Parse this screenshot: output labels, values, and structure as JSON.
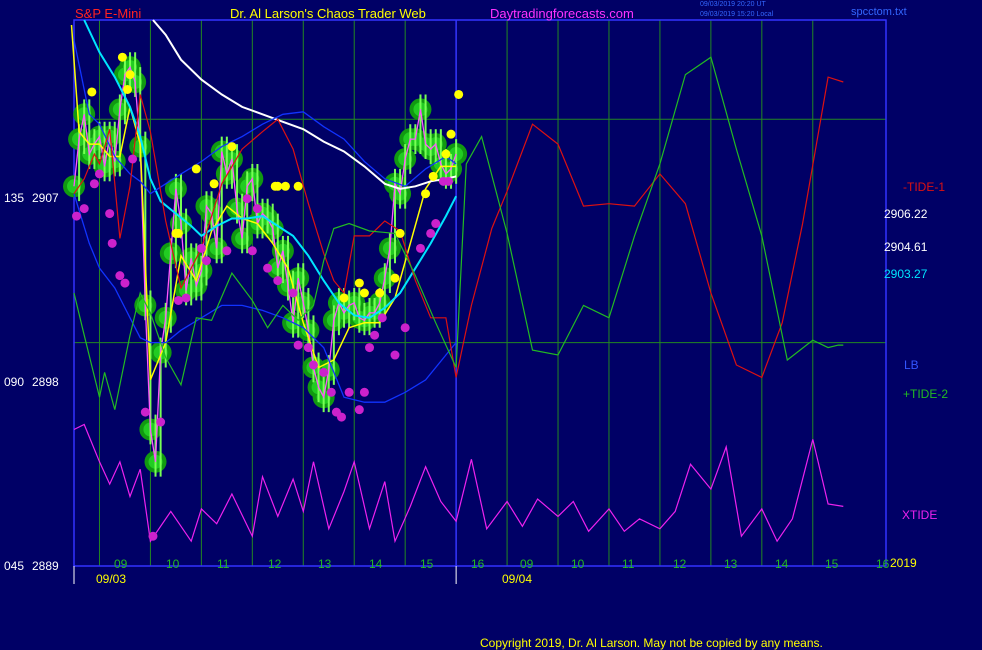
{
  "header": {
    "symbol": "S&P E-Mini",
    "site": "Dr. Al Larson's Chaos Trader Web",
    "url": "Daytradingforecasts.com",
    "ts_utc": "09/03/2019 20:20 UT",
    "ts_local": "09/03/2019 15:20 Local",
    "file": "spcctom.txt"
  },
  "footer": {
    "copyright": "Copyright 2019, Dr. Al Larson. May not be copied by any means."
  },
  "colors": {
    "background": "#000066",
    "frame": "#3333ff",
    "grid": "#228822",
    "price_lime": "#00ee00",
    "fast_ma_yellow": "#ffff00",
    "ma_cyan": "#00e5ff",
    "ma_white": "#ffffff",
    "bands_blue": "#1133ff",
    "tide1_red": "#dd1111",
    "tide2_green": "#22bb22",
    "xtide_magenta": "#ee22ee",
    "marker_yellow": "#ffff00",
    "marker_magenta": "#cc22cc"
  },
  "chart_data": {
    "type": "line",
    "x_axis": {
      "session1_date": "09/03",
      "session2_date": "09/04",
      "session1_hours": [
        "09",
        "10",
        "11",
        "12",
        "13",
        "14",
        "15",
        "16"
      ],
      "session2_hours": [
        "09",
        "10",
        "11",
        "12",
        "13",
        "14",
        "15",
        "16"
      ],
      "year": "2019"
    },
    "y_axis": {
      "ylim": [
        2889,
        2911
      ],
      "ticks": [
        {
          "prefix": "045",
          "value": "2889",
          "v": 2889
        },
        {
          "prefix": "090",
          "value": "2898",
          "v": 2898
        },
        {
          "prefix": "135",
          "value": "2907",
          "v": 2907
        }
      ]
    },
    "right_labels": {
      "value_1": "2906.22",
      "value_2": "2904.61",
      "value_3": "2903.27",
      "tide1": "-TIDE-1",
      "lb": "LB",
      "tide2": "+TIDE-2",
      "xtide": "XTIDE",
      "year": "2019"
    },
    "price": {
      "t": [
        8.5,
        8.6,
        8.7,
        8.8,
        8.9,
        9.0,
        9.1,
        9.2,
        9.3,
        9.4,
        9.5,
        9.6,
        9.7,
        9.8,
        9.9,
        10.0,
        10.1,
        10.2,
        10.3,
        10.4,
        10.5,
        10.6,
        10.7,
        10.8,
        10.9,
        11.0,
        11.1,
        11.2,
        11.3,
        11.4,
        11.5,
        11.6,
        11.7,
        11.8,
        11.9,
        12.0,
        12.1,
        12.2,
        12.3,
        12.4,
        12.5,
        12.6,
        12.7,
        12.8,
        12.9,
        13.0,
        13.1,
        13.2,
        13.3,
        13.4,
        13.5,
        13.6,
        13.7,
        13.8,
        13.9,
        14.0,
        14.1,
        14.2,
        14.3,
        14.4,
        14.5,
        14.6,
        14.7,
        14.8,
        14.9,
        15.0,
        15.1,
        15.2,
        15.3,
        15.4,
        15.5,
        15.6,
        15.7,
        15.8,
        15.9,
        16.0
      ],
      "v": [
        2904.3,
        2906.2,
        2907.2,
        2905.6,
        2906.0,
        2906.3,
        2905.1,
        2906.3,
        2905.3,
        2907.4,
        2908.8,
        2909.1,
        2908.5,
        2905.9,
        2899.5,
        2894.5,
        2893.2,
        2897.6,
        2899.0,
        2901.6,
        2904.2,
        2902.8,
        2900.1,
        2901.4,
        2900.3,
        2900.9,
        2903.5,
        2903.2,
        2901.8,
        2905.7,
        2904.8,
        2905.4,
        2903.4,
        2902.2,
        2904.3,
        2904.6,
        2902.8,
        2903.2,
        2903.0,
        2902.6,
        2901.0,
        2901.7,
        2900.3,
        2898.8,
        2900.6,
        2899.6,
        2898.5,
        2897.0,
        2896.2,
        2895.8,
        2896.9,
        2898.9,
        2899.6,
        2899.2,
        2899.5,
        2899.6,
        2899.0,
        2898.9,
        2899.2,
        2899.2,
        2899.6,
        2900.6,
        2901.8,
        2904.4,
        2904.0,
        2905.4,
        2906.2,
        2906.2,
        2907.4,
        2906.0,
        2905.8,
        2906.0,
        2905.2,
        2904.8,
        2905.0,
        2905.6
      ]
    },
    "series": [
      {
        "t": [
          8.45,
          8.6,
          8.8,
          9.0,
          9.2,
          9.4,
          9.6,
          9.8,
          10.0,
          10.3,
          10.6,
          10.9,
          11.2,
          11.5,
          11.8,
          12.1,
          12.4,
          12.7,
          13.0,
          13.3,
          13.6,
          13.9,
          14.2,
          14.5,
          14.8,
          15.1,
          15.4,
          15.7,
          16.0
        ],
        "v": [
          2910.8,
          2906.5,
          2906.0,
          2906.0,
          2905.5,
          2905.5,
          2907.5,
          2906.0,
          2896.5,
          2898.0,
          2901.5,
          2900.5,
          2902.5,
          2903.5,
          2903.0,
          2902.8,
          2902.0,
          2901.0,
          2898.8,
          2897.0,
          2897.3,
          2898.6,
          2898.8,
          2898.8,
          2899.8,
          2902.0,
          2904.2,
          2905.1,
          2905.1
        ]
      },
      {
        "t": [
          8.7,
          9.0,
          9.3,
          9.6,
          9.8,
          10.0,
          10.2,
          10.5,
          10.8,
          11.0,
          11.3,
          11.6,
          11.9,
          12.2,
          12.5,
          12.8,
          13.1,
          13.4,
          13.7,
          14.0,
          14.3,
          14.6,
          14.9,
          15.2,
          15.5,
          15.8,
          16.0
        ],
        "v": [
          2911.0,
          2909.7,
          2908.7,
          2907.5,
          2906.3,
          2904.6,
          2903.7,
          2903.2,
          2902.7,
          2902.3,
          2902.7,
          2903.0,
          2903.0,
          2903.1,
          2902.7,
          2902.3,
          2901.5,
          2900.5,
          2899.6,
          2899.1,
          2899.0,
          2899.4,
          2900.0,
          2901.0,
          2902.0,
          2903.1,
          2903.9
        ]
      },
      {
        "t": [
          10.05,
          10.3,
          10.6,
          11.0,
          11.4,
          11.8,
          12.2,
          12.6,
          13.0,
          13.4,
          13.8,
          14.2,
          14.6,
          14.9,
          15.2,
          15.5,
          15.8,
          16.0
        ],
        "v": [
          2911.0,
          2910.4,
          2909.4,
          2908.6,
          2908.0,
          2907.5,
          2907.2,
          2906.9,
          2906.6,
          2906.1,
          2905.7,
          2905.1,
          2904.4,
          2904.2,
          2904.3,
          2904.5,
          2904.6,
          2904.7
        ]
      },
      {
        "t": [
          8.5,
          8.8,
          9.0,
          9.3,
          9.6,
          9.8,
          10.0,
          10.3,
          10.6,
          11.0,
          11.4,
          11.8,
          12.2,
          12.6,
          13.0,
          13.4,
          13.8,
          14.2,
          14.6,
          15.0,
          15.4,
          15.8,
          16.0
        ],
        "v": [
          2910.2,
          2907.2,
          2906.8,
          2905.5,
          2904.8,
          2904.5,
          2904.0,
          2904.4,
          2904.8,
          2905.3,
          2905.9,
          2906.3,
          2906.8,
          2907.2,
          2907.3,
          2906.7,
          2906.2,
          2905.3,
          2904.6,
          2904.3,
          2905.0,
          2905.5,
          2905.2
        ]
      },
      {
        "t": [
          8.5,
          8.8,
          9.0,
          9.3,
          9.6,
          9.8,
          10.0,
          10.3,
          10.6,
          11.0,
          11.4,
          11.8,
          12.2,
          12.6,
          13.0,
          13.4,
          13.8,
          14.2,
          14.6,
          15.0,
          15.4,
          15.8,
          16.0
        ],
        "v": [
          2904.0,
          2902.0,
          2901.0,
          2900.2,
          2899.0,
          2898.2,
          2898.0,
          2898.0,
          2898.5,
          2899.0,
          2899.5,
          2899.5,
          2899.3,
          2899.0,
          2898.6,
          2897.8,
          2895.8,
          2895.6,
          2895.6,
          2896.0,
          2896.5,
          2897.5,
          2898.0
        ]
      },
      {
        "t": [
          8.5,
          8.7,
          8.9,
          9.0,
          9.2,
          9.4,
          9.6,
          9.8,
          10.0,
          10.3,
          10.6,
          11.0,
          11.4,
          11.8,
          12.2,
          12.5,
          12.8,
          13.1,
          13.4,
          13.6,
          13.8,
          14.0,
          14.3,
          14.6,
          14.9,
          15.2,
          15.5,
          15.8,
          16.0,
          16.3,
          16.7,
          17.0,
          17.5,
          18.0,
          18.5,
          19.0,
          19.5,
          20.0,
          20.5,
          21.0,
          21.5,
          22.0,
          22.4,
          22.8,
          23.3,
          23.6
        ],
        "v": [
          2904.0,
          2904.6,
          2905.6,
          2905.2,
          2906.6,
          2902.2,
          2904.3,
          2908.0,
          2906.5,
          2902.9,
          2900.2,
          2901.8,
          2904.4,
          2905.8,
          2906.5,
          2907.0,
          2905.8,
          2903.6,
          2901.6,
          2900.5,
          2900.0,
          2902.3,
          2902.3,
          2902.9,
          2902.5,
          2900.5,
          2899.0,
          2899.0,
          2896.6,
          2899.5,
          2902.6,
          2904.1,
          2906.8,
          2906.0,
          2903.5,
          2903.6,
          2903.5,
          2904.8,
          2903.6,
          2900.0,
          2897.1,
          2896.6,
          2898.8,
          2902.8,
          2908.7,
          2908.5
        ]
      },
      {
        "t": [
          8.5,
          8.7,
          9.0,
          9.1,
          9.3,
          9.6,
          9.8,
          10.0,
          10.3,
          10.6,
          10.9,
          11.2,
          11.6,
          12.0,
          12.3,
          12.6,
          12.9,
          13.2,
          13.4,
          13.6,
          13.9,
          14.3,
          14.8,
          15.2,
          15.6,
          16.0,
          16.2,
          16.5,
          17.0,
          17.5,
          18.0,
          18.5,
          19.0,
          19.5,
          20.0,
          20.5,
          21.0,
          21.5,
          22.0,
          22.5,
          23.0,
          23.3,
          23.5,
          23.6
        ],
        "v": [
          2900.0,
          2898.3,
          2895.8,
          2896.8,
          2895.3,
          2898.3,
          2900.0,
          2899.2,
          2897.4,
          2896.3,
          2899.0,
          2898.9,
          2900.8,
          2899.7,
          2898.6,
          2899.5,
          2898.9,
          2899.5,
          2901.3,
          2902.6,
          2902.8,
          2902.5,
          2902.4,
          2900.7,
          2898.8,
          2897.0,
          2905.2,
          2906.3,
          2902.4,
          2897.7,
          2897.5,
          2899.5,
          2899.0,
          2902.3,
          2905.2,
          2908.8,
          2909.5,
          2905.8,
          2902.3,
          2897.3,
          2898.1,
          2897.8,
          2897.9,
          2897.9
        ]
      },
      {
        "t": [
          8.5,
          8.7,
          9.0,
          9.2,
          9.4,
          9.6,
          9.8,
          10.0,
          10.4,
          10.8,
          11.0,
          11.3,
          11.6,
          12.0,
          12.2,
          12.5,
          12.8,
          13.0,
          13.2,
          13.5,
          13.8,
          14.0,
          14.3,
          14.6,
          14.8,
          15.1,
          15.4,
          15.7,
          16.0,
          16.3,
          16.6,
          17.0,
          17.3,
          17.6,
          18.0,
          18.3,
          18.6,
          19.0,
          19.3,
          19.6,
          20.0,
          20.3,
          20.6,
          21.0,
          21.3,
          21.6,
          22.0,
          22.3,
          22.6,
          23.0,
          23.3,
          23.6
        ],
        "v": [
          2894.5,
          2894.7,
          2893.2,
          2892.3,
          2893.2,
          2891.8,
          2892.9,
          2890.0,
          2891.2,
          2890.0,
          2891.3,
          2890.7,
          2891.9,
          2890.2,
          2892.6,
          2891.0,
          2892.5,
          2891.2,
          2893.2,
          2890.5,
          2892.0,
          2893.2,
          2890.5,
          2892.4,
          2890.0,
          2891.4,
          2893.0,
          2891.6,
          2890.8,
          2893.3,
          2890.5,
          2891.6,
          2890.6,
          2891.7,
          2891.0,
          2891.6,
          2890.4,
          2891.3,
          2890.4,
          2890.9,
          2890.5,
          2891.2,
          2893.1,
          2892.1,
          2893.8,
          2890.2,
          2891.3,
          2890.0,
          2890.9,
          2894.1,
          2891.5,
          2891.4
        ]
      }
    ],
    "markers_yellow": [
      [
        8.85,
        2908.1
      ],
      [
        9.45,
        2909.5
      ],
      [
        9.55,
        2908.2
      ],
      [
        9.6,
        2908.8
      ],
      [
        10.5,
        2902.4
      ],
      [
        10.55,
        2902.4
      ],
      [
        10.9,
        2905.0
      ],
      [
        11.25,
        2904.4
      ],
      [
        11.6,
        2905.9
      ],
      [
        12.45,
        2904.3
      ],
      [
        12.5,
        2904.3
      ],
      [
        12.65,
        2904.3
      ],
      [
        12.9,
        2904.3
      ],
      [
        13.8,
        2899.8
      ],
      [
        14.1,
        2900.4
      ],
      [
        14.2,
        2900.0
      ],
      [
        14.5,
        2900.0
      ],
      [
        14.8,
        2900.6
      ],
      [
        14.9,
        2902.4
      ],
      [
        15.4,
        2904.0
      ],
      [
        15.55,
        2904.7
      ],
      [
        15.8,
        2905.6
      ],
      [
        15.9,
        2906.4
      ],
      [
        16.05,
        2908.0
      ]
    ],
    "markers_magenta": [
      [
        8.55,
        2903.1
      ],
      [
        8.7,
        2903.4
      ],
      [
        8.9,
        2904.4
      ],
      [
        9.0,
        2904.8
      ],
      [
        9.2,
        2903.2
      ],
      [
        9.25,
        2902.0
      ],
      [
        9.4,
        2900.7
      ],
      [
        9.5,
        2900.4
      ],
      [
        9.65,
        2905.4
      ],
      [
        9.9,
        2895.2
      ],
      [
        10.05,
        2890.2
      ],
      [
        10.2,
        2894.8
      ],
      [
        10.55,
        2899.7
      ],
      [
        10.7,
        2899.8
      ],
      [
        11.0,
        2901.8
      ],
      [
        11.1,
        2901.3
      ],
      [
        11.5,
        2901.7
      ],
      [
        11.9,
        2903.8
      ],
      [
        12.0,
        2901.7
      ],
      [
        12.1,
        2903.4
      ],
      [
        12.3,
        2901.0
      ],
      [
        12.5,
        2900.5
      ],
      [
        12.8,
        2900.0
      ],
      [
        12.9,
        2897.9
      ],
      [
        13.1,
        2897.8
      ],
      [
        13.2,
        2897.1
      ],
      [
        13.4,
        2896.8
      ],
      [
        13.55,
        2896.0
      ],
      [
        13.65,
        2895.2
      ],
      [
        13.75,
        2895.0
      ],
      [
        13.9,
        2896.0
      ],
      [
        14.1,
        2895.3
      ],
      [
        14.2,
        2896.0
      ],
      [
        14.3,
        2897.8
      ],
      [
        14.4,
        2898.3
      ],
      [
        14.55,
        2899.0
      ],
      [
        14.8,
        2897.5
      ],
      [
        15.0,
        2898.6
      ],
      [
        15.3,
        2901.8
      ],
      [
        15.5,
        2902.4
      ],
      [
        15.6,
        2902.8
      ],
      [
        15.75,
        2904.5
      ],
      [
        15.85,
        2904.5
      ]
    ]
  }
}
